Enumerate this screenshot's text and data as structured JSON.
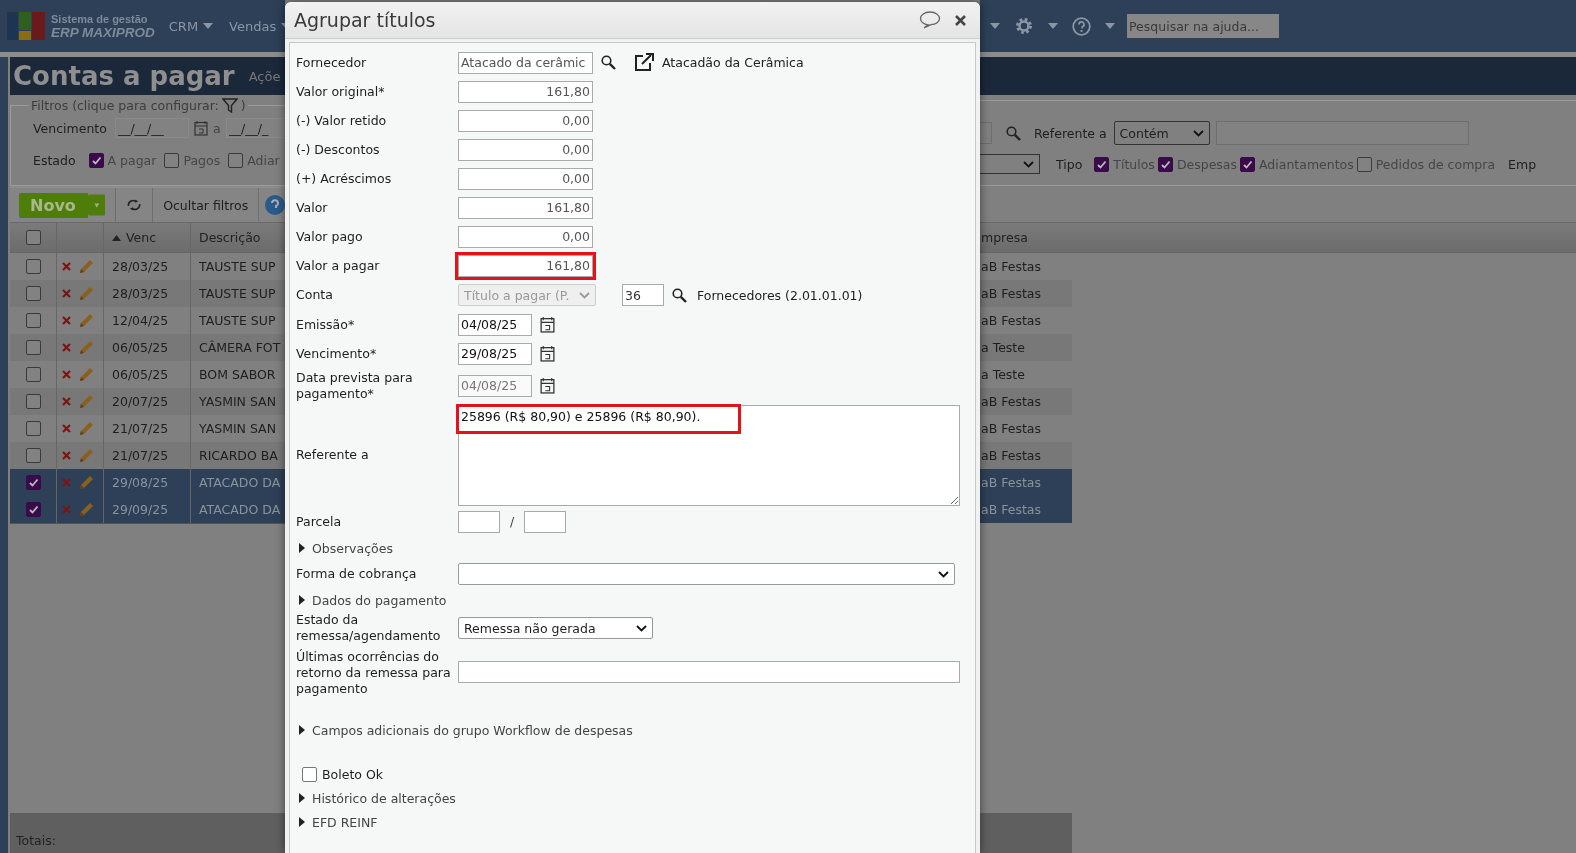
{
  "app": {
    "brand_line1": "Sistema de gestão",
    "brand_line2": "ERP MAXIPROD",
    "menu": [
      "CRM",
      "Vendas"
    ],
    "help_search": {
      "placeholder": "Pesquisar na ajuda..."
    }
  },
  "page": {
    "title": "Contas a pagar",
    "actions_label": "Açõe"
  },
  "filters": {
    "legend": "Filtros (clique para configurar:",
    "legend_close": ")",
    "due_label": "Vencimento",
    "due_from": {
      "placeholder": "__/__/__"
    },
    "due_sep": "a",
    "due_to": {
      "placeholder": "__/__/_"
    },
    "state_label": "Estado",
    "states": [
      {
        "label": "A pagar",
        "checked": true
      },
      {
        "label": "Pagos",
        "checked": false
      },
      {
        "label": "Adiar",
        "checked": false
      }
    ],
    "referente_label": "Referente a",
    "referente_mode": "Contém",
    "type_label": "Tipo",
    "types": [
      {
        "label": "Títulos",
        "checked": true
      },
      {
        "label": "Despesas",
        "checked": true
      },
      {
        "label": "Adiantamentos",
        "checked": true
      },
      {
        "label": "Pedidos de compra",
        "checked": false
      }
    ],
    "company_label": "Emp"
  },
  "toolbar": {
    "new": "Novo",
    "hide_filters": "Ocultar filtros"
  },
  "table": {
    "columns": [
      "Venc",
      "Descrição",
      "mpresa"
    ],
    "rows": [
      {
        "due": "28/03/25",
        "description": "TAUSTE SUP",
        "company": "aB Festas",
        "selected": false
      },
      {
        "due": "28/03/25",
        "description": "TAUSTE SUP",
        "company": "aB Festas",
        "selected": false
      },
      {
        "due": "12/04/25",
        "description": "TAUSTE SUP",
        "company": "aB Festas",
        "selected": false
      },
      {
        "due": "06/05/25",
        "description": "CÂMERA FOT",
        "company": "a Teste",
        "selected": false
      },
      {
        "due": "06/05/25",
        "description": "BOM SABOR",
        "company": "a Teste",
        "selected": false
      },
      {
        "due": "20/07/25",
        "description": "YASMIN SAN",
        "company": "aB Festas",
        "selected": false
      },
      {
        "due": "21/07/25",
        "description": "YASMIN SAN",
        "company": "aB Festas",
        "selected": false
      },
      {
        "due": "21/07/25",
        "description": "RICARDO BA",
        "company": "aB Festas",
        "selected": false
      },
      {
        "due": "29/08/25",
        "description": "ATACADO DA",
        "company": "aB Festas",
        "selected": true
      },
      {
        "due": "29/09/25",
        "description": "ATACADO DA",
        "company": "aB Festas",
        "selected": true
      }
    ],
    "totals_label": "Totais:",
    "select_all_checked": false
  },
  "dialog": {
    "title": "Agrupar títulos",
    "fields": [
      {
        "kind": "lookup",
        "label": "Fornecedor",
        "value": "Atacado da cerâmic",
        "link_text": "Atacadão da Cerâmica"
      },
      {
        "kind": "money",
        "label": "Valor original*",
        "value": "161,80",
        "highlighted": false
      },
      {
        "kind": "money",
        "label": "(-) Valor retido",
        "value": "0,00",
        "highlighted": false
      },
      {
        "kind": "money",
        "label": "(-) Descontos",
        "value": "0,00",
        "highlighted": false
      },
      {
        "kind": "money",
        "label": "(+) Acréscimos",
        "value": "0,00",
        "highlighted": false
      },
      {
        "kind": "money",
        "label": "Valor",
        "value": "161,80",
        "highlighted": false
      },
      {
        "kind": "money",
        "label": "Valor pago",
        "value": "0,00",
        "highlighted": false
      },
      {
        "kind": "money",
        "label": "Valor a pagar",
        "value": "161,80",
        "highlighted": true
      },
      {
        "kind": "account",
        "label": "Conta",
        "value": "Título a pagar (P.",
        "code": "36",
        "account_name": "Fornecedores (2.01.01.01)",
        "disabled": true
      },
      {
        "kind": "date",
        "label": "Emissão*",
        "value": "04/08/25",
        "disabled": false
      },
      {
        "kind": "date",
        "label": "Vencimento*",
        "value": "29/08/25",
        "disabled": false
      },
      {
        "kind": "date",
        "label": "Data prevista para pagamento*",
        "value": "04/08/25",
        "disabled": true
      },
      {
        "kind": "textarea",
        "label": "Referente a",
        "value": "25896 (R$ 80,90) e 25896 (R$ 80,90).",
        "highlighted": true
      },
      {
        "kind": "installment",
        "label": "Parcela",
        "separator": "/"
      },
      {
        "kind": "section",
        "label": "Observações"
      },
      {
        "kind": "select",
        "label": "Forma de cobrança"
      },
      {
        "kind": "section",
        "label": "Dados do pagamento"
      },
      {
        "kind": "select",
        "label": "Estado da remessa/agendamento",
        "value": "Remessa não gerada"
      },
      {
        "kind": "text",
        "label": "Últimas ocorrências do retorno da remessa para pagamento"
      },
      {
        "kind": "section",
        "label": "Campos adicionais do grupo Workflow de despesas"
      },
      {
        "kind": "checkbox",
        "label": "Boleto Ok",
        "checked": false
      },
      {
        "kind": "section",
        "label": "Histórico de alterações"
      },
      {
        "kind": "section",
        "label": "EFD REINF"
      }
    ]
  }
}
